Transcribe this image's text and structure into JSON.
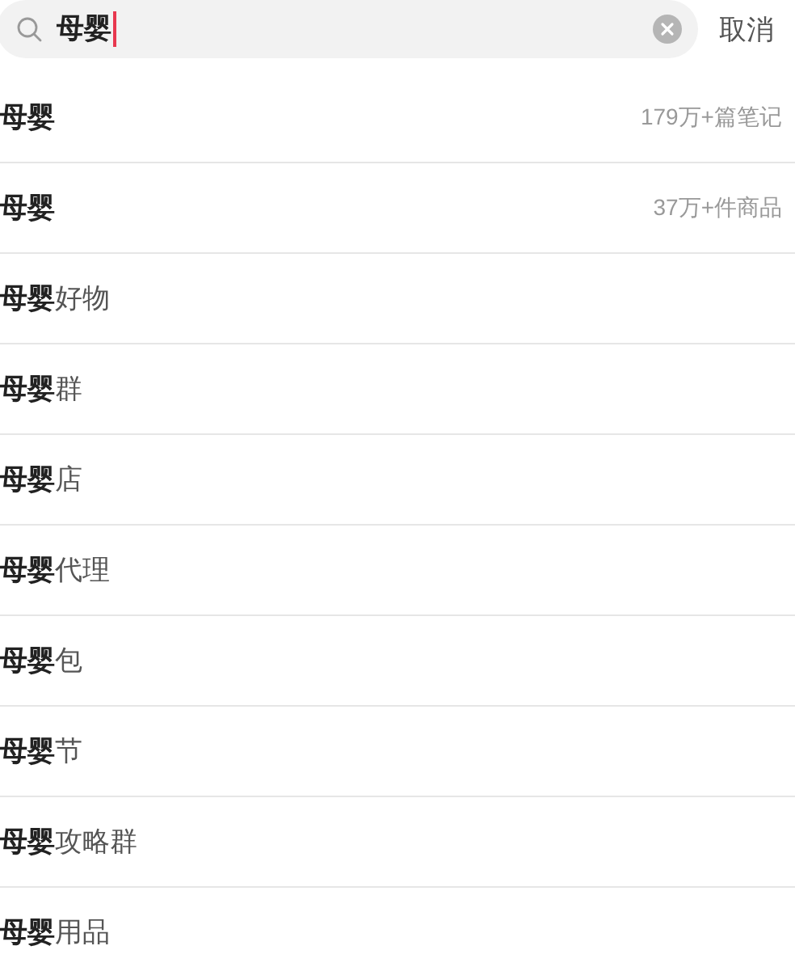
{
  "search": {
    "value": "母婴",
    "cancel": "取消"
  },
  "suggestions": [
    {
      "text": "**母婴**",
      "count": "179万+篇笔记"
    },
    {
      "text": "**母婴**",
      "count": "37万+件商品"
    },
    {
      "text": "**母婴**好物"
    },
    {
      "text": "**母婴**群"
    },
    {
      "text": "**母婴**店"
    },
    {
      "text": "**母婴**代理"
    },
    {
      "text": "**母婴**包"
    },
    {
      "text": "**母婴**节"
    },
    {
      "text": "**母婴**攻略群"
    },
    {
      "text": "**母婴**用品"
    }
  ]
}
